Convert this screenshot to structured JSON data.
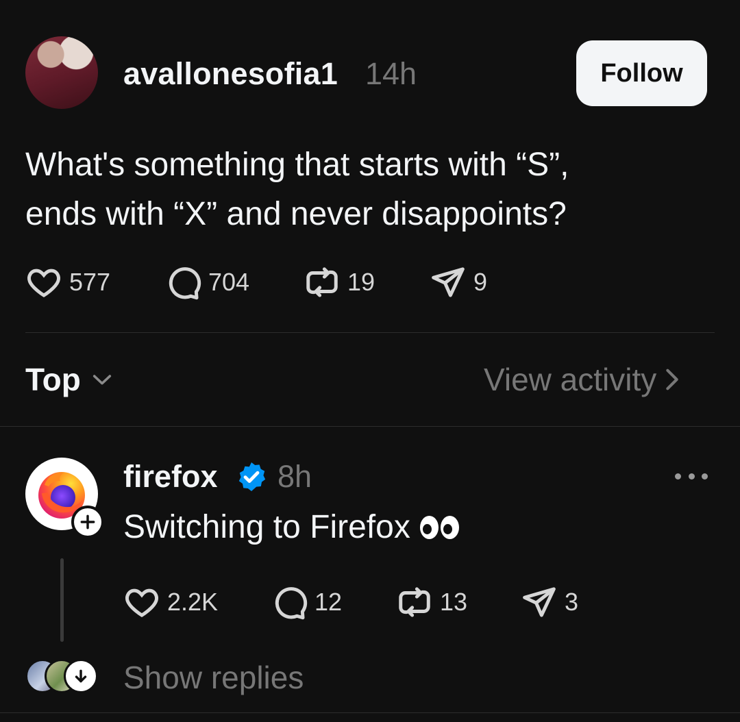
{
  "post": {
    "username": "avallonesofia1",
    "time": "14h",
    "follow_label": "Follow",
    "text_lines": [
      "What's something that starts with “S”,",
      "ends with “X” and never disappoints?"
    ],
    "stats": {
      "likes": "577",
      "replies": "704",
      "reposts": "19",
      "shares": "9"
    }
  },
  "replies_header": {
    "sort_label": "Top",
    "view_activity_label": "View activity"
  },
  "reply": {
    "username": "firefox",
    "verified": true,
    "time": "8h",
    "text": "Switching to Firefox",
    "emoji": "eyes",
    "stats": {
      "likes": "2.2K",
      "replies": "12",
      "reposts": "13",
      "shares": "3"
    },
    "show_replies_label": "Show replies"
  },
  "colors": {
    "background": "#101010",
    "primary_text": "#f3f5f7",
    "secondary_text": "#777777",
    "verified_blue": "#0095f6"
  }
}
